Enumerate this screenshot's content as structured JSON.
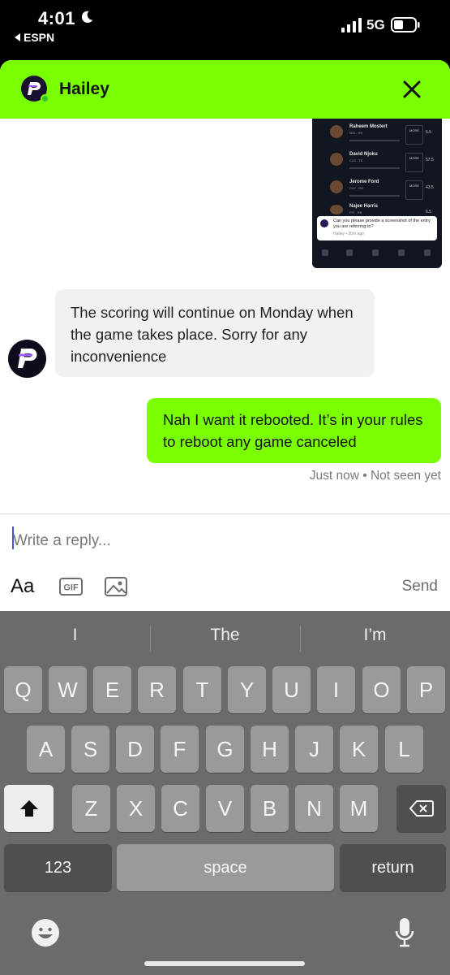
{
  "status_bar": {
    "time": "4:01",
    "back_app": "ESPN",
    "network": "5G"
  },
  "header": {
    "name": "Hailey"
  },
  "shared_screenshot": {
    "players": [
      {
        "name": "Raheem Mostert",
        "team": "MIA - RB",
        "more": "MORE",
        "tag": "6.5"
      },
      {
        "name": "David Njoku",
        "team": "CLE - TE",
        "more": "MORE",
        "tag": "57.5"
      },
      {
        "name": "Jerome Ford",
        "team": "CLE - RB",
        "more": "MORE",
        "tag": "43.5"
      },
      {
        "name": "Najee Harris",
        "team": "PIT - RB",
        "more": "MORE",
        "tag": "6.5"
      }
    ],
    "bubble_text": "Can you please provide a screenshot of the entry you are referring to?",
    "bubble_meta": "Hailey • 35m ago"
  },
  "messages": [
    {
      "from": "agent",
      "text": "The scoring will continue on Monday when the game takes place. Sorry for any inconvenience"
    },
    {
      "from": "user",
      "text": "Nah I want it rebooted. It’s in your rules to reboot any game canceled"
    }
  ],
  "message_meta": "Just now • Not seen yet",
  "composer": {
    "placeholder": "Write a reply...",
    "aa_label": "Aa",
    "gif_label": "GIF",
    "send_label": "Send"
  },
  "keyboard": {
    "suggestions": [
      "I",
      "The",
      "I’m"
    ],
    "row1": [
      "Q",
      "W",
      "E",
      "R",
      "T",
      "Y",
      "U",
      "I",
      "O",
      "P"
    ],
    "row2": [
      "A",
      "S",
      "D",
      "F",
      "G",
      "H",
      "J",
      "K",
      "L"
    ],
    "row3": [
      "Z",
      "X",
      "C",
      "V",
      "B",
      "N",
      "M"
    ],
    "numbers_label": "123",
    "space_label": "space",
    "return_label": "return"
  },
  "colors": {
    "accent": "#7aff00",
    "keyboard_bg": "#6b6b6b"
  }
}
